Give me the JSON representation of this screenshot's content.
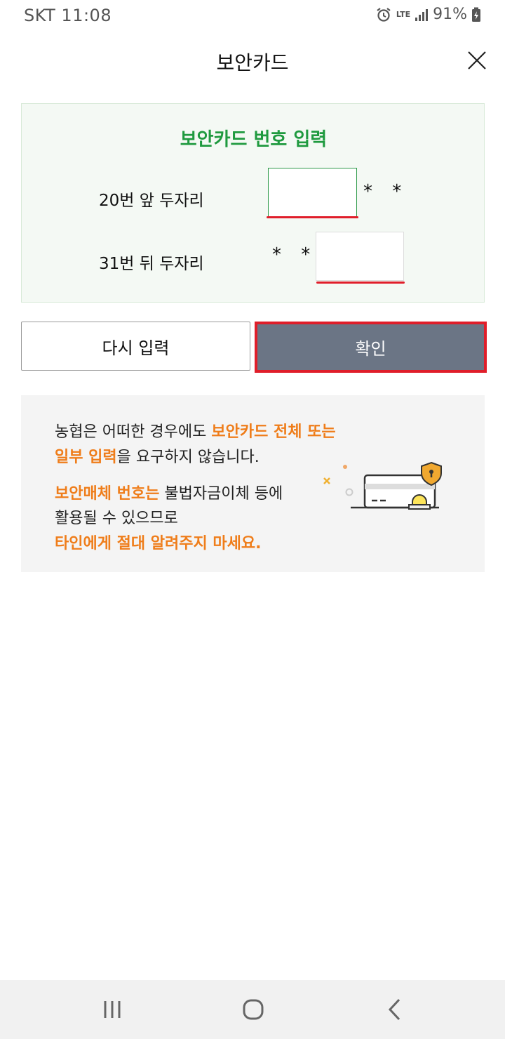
{
  "status": {
    "carrier": "SKT",
    "time": "11:08",
    "network_top": "LTE",
    "battery": "91%"
  },
  "header": {
    "title": "보안카드"
  },
  "panel": {
    "title": "보안카드 번호 입력",
    "row1_label": "20번 앞 두자리",
    "row1_mask": "* *",
    "row2_label": "31번 뒤 두자리",
    "row2_mask": "* *",
    "input1_value": "",
    "input2_value": ""
  },
  "buttons": {
    "retry": "다시 입력",
    "confirm": "확인"
  },
  "notice": {
    "line1_normal": "농협은 어떠한 경우에도 ",
    "line1_highlight": "보안카드 전체 또는",
    "line2_highlight": "일부 입력",
    "line2_normal": "을 요구하지 않습니다.",
    "line3_highlight": "보안매체 번호는",
    "line3_normal": " 불법자금이체 등에",
    "line4_normal": "활용될 수 있으므로",
    "line5_highlight": "타인에게 절대 알려주지 마세요."
  },
  "colors": {
    "panel_title": "#1f9a3f",
    "highlight": "#ef7d1a",
    "confirm_bg": "#6b7585",
    "annotation_red": "#e01e2a"
  },
  "icons": {
    "close": "close-icon",
    "alarm": "alarm-icon",
    "signal": "signal-icon",
    "battery": "battery-charging-icon",
    "nav_recent": "recent-apps-icon",
    "nav_home": "home-icon",
    "nav_back": "back-icon"
  }
}
